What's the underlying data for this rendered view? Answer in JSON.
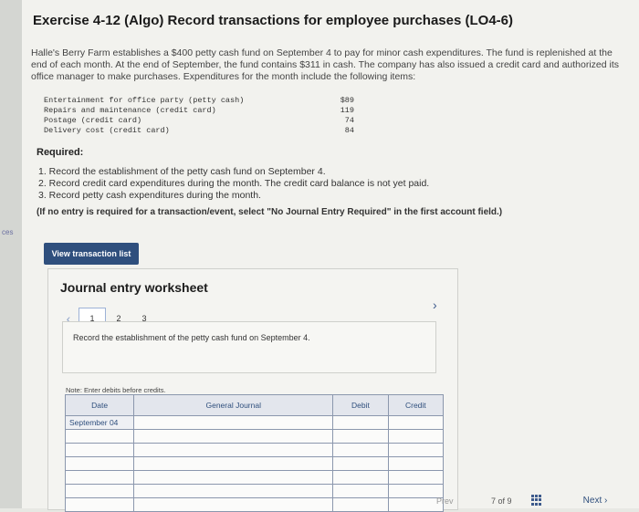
{
  "side_label": "ces",
  "exercise": {
    "title": "Exercise 4-12 (Algo) Record transactions for employee purchases (LO4-6)",
    "intro": "Halle's Berry Farm establishes a $400 petty cash fund on September 4 to pay for minor cash expenditures. The fund is replenished at the end of each month. At the end of September, the fund contains $311 in cash. The company has also issued a credit card and authorized its office manager to make purchases. Expenditures for the month include the following items:"
  },
  "expenditures": [
    {
      "item": "Entertainment for office party (petty cash)",
      "amount": "$89"
    },
    {
      "item": "Repairs and maintenance (credit card)",
      "amount": "119"
    },
    {
      "item": "Postage (credit card)",
      "amount": "74"
    },
    {
      "item": "Delivery cost (credit card)",
      "amount": "84"
    }
  ],
  "required": {
    "heading": "Required:",
    "items": [
      "1. Record the establishment of the petty cash fund on September 4.",
      "2. Record credit card expenditures during the month. The credit card balance is not yet paid.",
      "3. Record petty cash expenditures during the month."
    ],
    "note": "(If no entry is required for a transaction/event, select \"No Journal Entry Required\" in the first account field.)"
  },
  "view_button_label": "View transaction list",
  "worksheet": {
    "title": "Journal entry worksheet",
    "pages": [
      "1",
      "2",
      "3"
    ],
    "task": "Record the establishment of the petty cash fund on September 4.",
    "debits_note": "Note: Enter debits before credits.",
    "columns": {
      "date": "Date",
      "account": "General Journal",
      "debit": "Debit",
      "credit": "Credit"
    },
    "date_value": "September 04"
  },
  "footer": {
    "prev_label": "Prev",
    "page_count": "7 of 9",
    "next_label": "Next"
  }
}
